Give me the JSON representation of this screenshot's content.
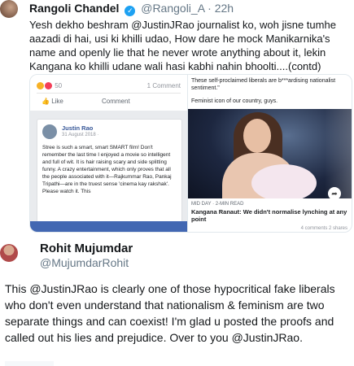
{
  "quoted_tweet": {
    "author_name": "Rangoli Chandel",
    "author_handle": "@Rangoli_A",
    "separator": "·",
    "time": "22h",
    "text": "Yesh dekho beshram @JustinJRao journalist ko, woh jisne tumhe aazadi di hai, usi ki khilli udao, How dare he mock Manikarnika's name and openly lie that he never wrote anything about it, lekin Kangana ko khilli udane wali hasi kabhi nahin bhoolti....(contd)",
    "image": {
      "facebook": {
        "reaction_count": "50",
        "comment_count": "1 Comment",
        "like_label": "Like",
        "reply_label": "Comment",
        "post_author": "Justin Rao",
        "post_date": "31 August 2018 · ",
        "post_text": "Stree is such a smart, smart SMART film! Don't remember the last time I enjoyed a movie so intelligent and full of wit. It is hair raising scary and side splitting funny. A crazy entertainment, which only proves that all the people associated with it—Rajkummar Rao, Pankaj Tripathi—are in the truest sense 'cinema kay rakshak'. Please watch it. This"
      },
      "article": {
        "quote": "These self-proclaimed liberals are b***ardising nationalist sentiment.\"",
        "subquote": "Feminist icon of our country, guys.",
        "meta": "MID DAY · 2-MIN READ",
        "headline": "Kangana Ranaut: We didn't normalise lynching at any point",
        "stats": "4 comments 2 shares"
      }
    }
  },
  "main_tweet": {
    "author_name": "Rohit Mujumdar",
    "author_handle": "@MujumdarRohit",
    "text": "This @JustinJRao is clearly one of those hypocritical fake liberals who don't even understand that nationalism & feminism are two separate things and can coexist! I'm glad u posted the proofs and called out his lies and prejudice. Over to you @JustinJRao."
  },
  "colors": {
    "handle_gray": "#657786",
    "verified_blue": "#1da1f2",
    "facebook_blue": "#4267b2"
  },
  "icons": [
    "verified-badge-icon",
    "like-thumb-icon",
    "share-icon"
  ]
}
